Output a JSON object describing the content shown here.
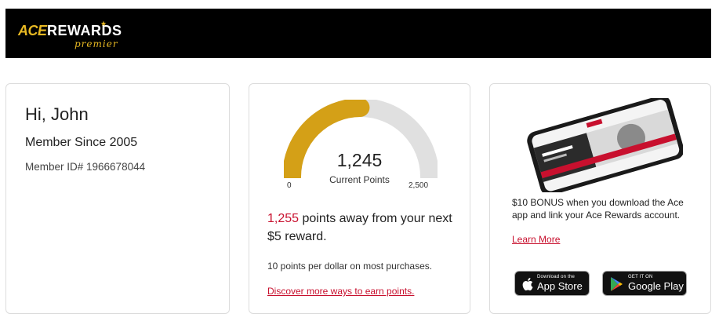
{
  "brand": {
    "name_part1": "ACE",
    "name_part2": "REWARDS",
    "tier": "premier",
    "accent_color": "#e8b923",
    "link_color": "#c8102e"
  },
  "member": {
    "greeting": "Hi, John",
    "since": "Member Since 2005",
    "id": "Member ID# 1966678044"
  },
  "points": {
    "current": "1,245",
    "current_label": "Current Points",
    "min_label": "0",
    "max_label": "2,500",
    "progress_fraction": 0.498,
    "away_value": "1,255",
    "away_text": " points away from your next $5 reward.",
    "earn_rate": "10 points per dollar on most purchases.",
    "discover_link": "Discover more ways to earn points."
  },
  "app_promo": {
    "bonus_text": "$10 BONUS when you download the Ace app and link your Ace Rewards account.",
    "learn_more": "Learn More",
    "app_store_small": "Download on the",
    "app_store_big": "App Store",
    "google_play_small": "GET IT ON",
    "google_play_big": "Google Play",
    "icons": [
      "apple-icon",
      "google-play-icon"
    ]
  }
}
